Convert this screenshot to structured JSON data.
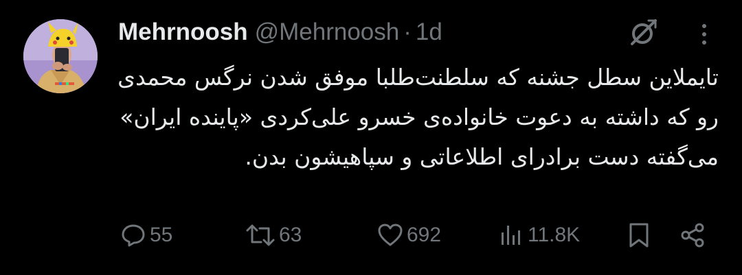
{
  "tweet": {
    "display_name": "Mehrnoosh",
    "handle": "@Mehrnoosh",
    "separator": "·",
    "time": "1d",
    "text": "تایملاین سطل جشنه که سلطنت‌طلبا موفق شدن نرگس محمدی رو که داشته به دعوت خانواده‌ی خسرو علی‌کردی «پاینده ایران» می‌گفته دست برادرای اطلاعاتی و سپاهیشون بدن."
  },
  "actions": {
    "replies": "55",
    "reposts": "63",
    "likes": "692",
    "views": "11.8K"
  },
  "icons": {
    "avatar": "avatar-photo",
    "grok": "grok-icon",
    "more": "more-vertical-icon",
    "reply": "reply-bubble-icon",
    "repost": "repost-icon",
    "like": "heart-icon",
    "views": "views-bar-icon",
    "bookmark": "bookmark-icon",
    "share": "share-icon"
  },
  "colors": {
    "background": "#000000",
    "primary_text": "#e7e9ea",
    "secondary_text": "#71767b"
  }
}
